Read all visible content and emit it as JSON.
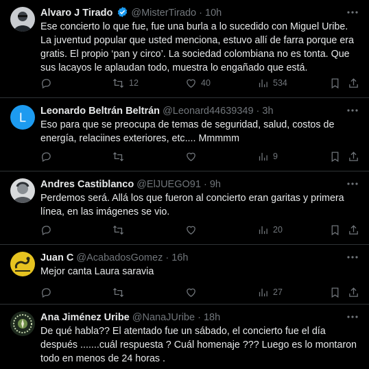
{
  "colors": {
    "background": "#000000",
    "text": "#e7e9ea",
    "secondary": "#71767b",
    "divider": "#2f3336",
    "verified_blue": "#1d9bf0",
    "avatar_l_bg": "#1d9bf0"
  },
  "tweets": [
    {
      "name": "Alvaro J Tirado",
      "verified": true,
      "handle": "@MisterTirado",
      "dot": "·",
      "time": "10h",
      "text": "Ese concierto lo que fue, fue una burla a lo sucedido con Miguel Uribe. La juventud popular que usted menciona, estuvo allí de farra porque era gratis. El propio ‘pan y circo’. La sociedad colombiana no es tonta. Que sus lacayos le aplaudan todo, muestra lo engañado que está.",
      "replies": "",
      "reposts": "12",
      "likes": "40",
      "views": "534",
      "avatar_icon": "profile-photo-icon"
    },
    {
      "name": "Leonardo Beltrán Beltrán",
      "verified": false,
      "handle": "@Leonard44639349",
      "dot": "·",
      "time": "3h",
      "text": "Eso para que se preocupa de temas de seguridad, salud, costos de energía, relaciines exteriores, etc.... Mmmmm",
      "replies": "",
      "reposts": "",
      "likes": "",
      "views": "9",
      "avatar_letter": "L"
    },
    {
      "name": "Andres Castiblanco",
      "verified": false,
      "handle": "@ElJUEGO91",
      "dot": "·",
      "time": "9h",
      "text": "Perdemos será. Allá los que fueron al concierto eran garitas y primera línea, en las imágenes se vio.",
      "replies": "",
      "reposts": "",
      "likes": "",
      "views": "20",
      "avatar_icon": "profile-photo-icon"
    },
    {
      "name": "Juan C",
      "verified": false,
      "handle": "@AcabadosGomez",
      "dot": "·",
      "time": "16h",
      "text": "Mejor canta Laura saravia",
      "replies": "",
      "reposts": "",
      "likes": "",
      "views": "27",
      "avatar_icon": "gadsden-flag-icon"
    },
    {
      "name": "Ana Jiménez Uribe",
      "verified": false,
      "handle": "@NanaJUribe",
      "dot": "·",
      "time": "18h",
      "text": "De qué habla?? El atentado fue un sábado, el concierto fue el día después .......cuál  respuesta ? Cuál homenaje ??? Luego es lo montaron todo en menos de 24 horas .",
      "avatar_icon": "emblem-icon"
    }
  ]
}
